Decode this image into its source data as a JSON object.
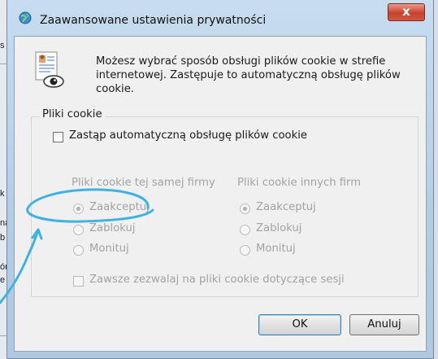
{
  "background": {
    "fragments": [
      "s",
      "k",
      "na",
      "b",
      "ór",
      "e"
    ]
  },
  "dialog": {
    "title": "Zaawansowane ustawienia prywatności",
    "close_label": "x",
    "info_text": "Możesz wybrać sposób obsługi plików cookie w strefie internetowej. Zastępuje to automatyczną obsługę plików cookie.",
    "group_label": "Pliki cookie",
    "override_label": "Zastąp automatyczną obsługę plików cookie",
    "first_party": {
      "header": "Pliki cookie tej samej firmy",
      "options": [
        "Zaakceptuj",
        "Zablokuj",
        "Monituj"
      ],
      "selected": "Zaakceptuj"
    },
    "third_party": {
      "header": "Pliki cookie innych firm",
      "options": [
        "Zaakceptuj",
        "Zablokuj",
        "Monituj"
      ],
      "selected": "Zaakceptuj"
    },
    "session_label": "Zawsze zezwalaj na pliki cookie dotyczące sesji",
    "ok_label": "OK",
    "cancel_label": "Anuluj"
  },
  "colors": {
    "annotation_stroke": "#3fb2e2",
    "close_button": "#c8412a",
    "frame": "#b5cde4"
  },
  "icons": [
    "globe-icon",
    "privacy-document-eye-icon"
  ]
}
